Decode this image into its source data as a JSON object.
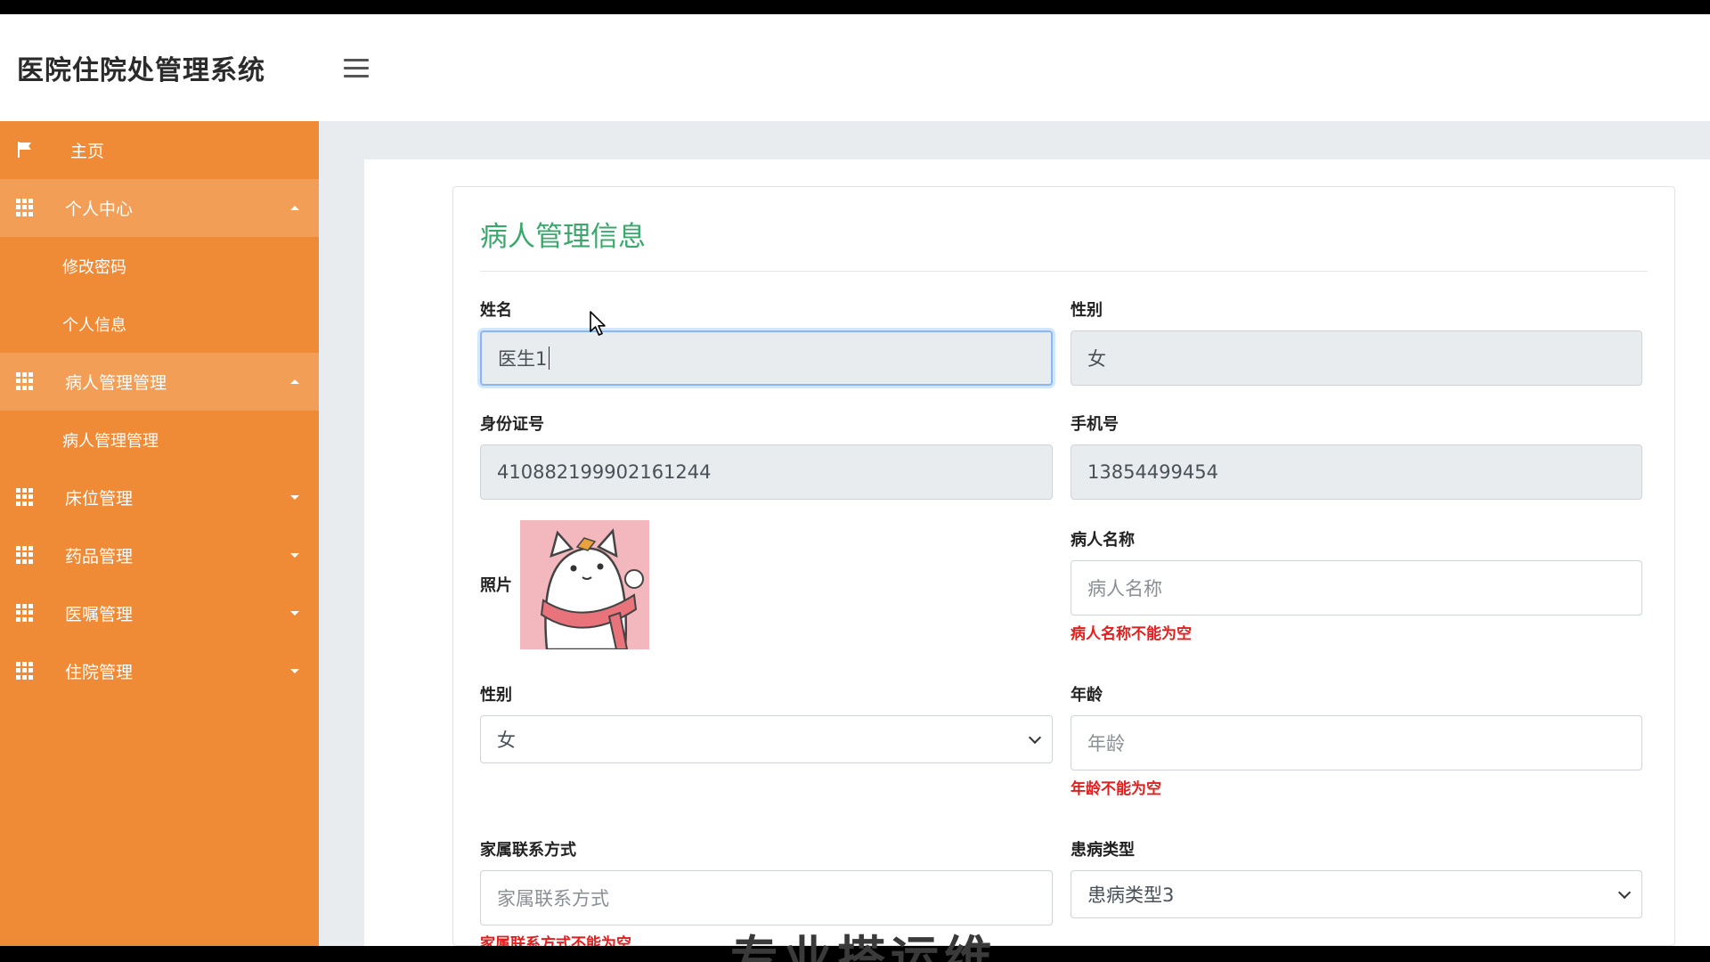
{
  "app": {
    "title": "医院住院处管理系统"
  },
  "sidebar": {
    "items": [
      {
        "label": "主页",
        "icon": "flag-icon"
      },
      {
        "label": "个人中心",
        "icon": "grid-icon",
        "expanded": true,
        "children": [
          {
            "label": "修改密码"
          },
          {
            "label": "个人信息"
          }
        ]
      },
      {
        "label": "病人管理管理",
        "icon": "grid-icon",
        "expanded": true,
        "children": [
          {
            "label": "病人管理管理"
          }
        ]
      },
      {
        "label": "床位管理",
        "icon": "grid-icon",
        "expanded": false
      },
      {
        "label": "药品管理",
        "icon": "grid-icon",
        "expanded": false
      },
      {
        "label": "医嘱管理",
        "icon": "grid-icon",
        "expanded": false
      },
      {
        "label": "住院管理",
        "icon": "grid-icon",
        "expanded": false
      }
    ]
  },
  "form": {
    "title": "病人管理信息",
    "name": {
      "label": "姓名",
      "value": "医生1"
    },
    "gender_doctor": {
      "label": "性别",
      "value": "女"
    },
    "id_number": {
      "label": "身份证号",
      "value": "410882199902161244"
    },
    "phone": {
      "label": "手机号",
      "value": "13854499454"
    },
    "photo": {
      "label": "照片"
    },
    "patient_name": {
      "label": "病人名称",
      "placeholder": "病人名称",
      "error": "病人名称不能为空"
    },
    "patient_gender": {
      "label": "性别",
      "value": "女"
    },
    "age": {
      "label": "年龄",
      "placeholder": "年龄",
      "error": "年龄不能为空"
    },
    "family_contact": {
      "label": "家属联系方式",
      "placeholder": "家属联系方式",
      "error": "家属联系方式不能为空"
    },
    "disease_type": {
      "label": "患病类型",
      "value": "患病类型3"
    }
  },
  "overlay": {
    "watermark": "专业搭运维"
  },
  "colors": {
    "sidebar": "#ef8a37",
    "sidebar_open": "#f29e57",
    "title": "#3aa76d",
    "error": "#e02020"
  }
}
